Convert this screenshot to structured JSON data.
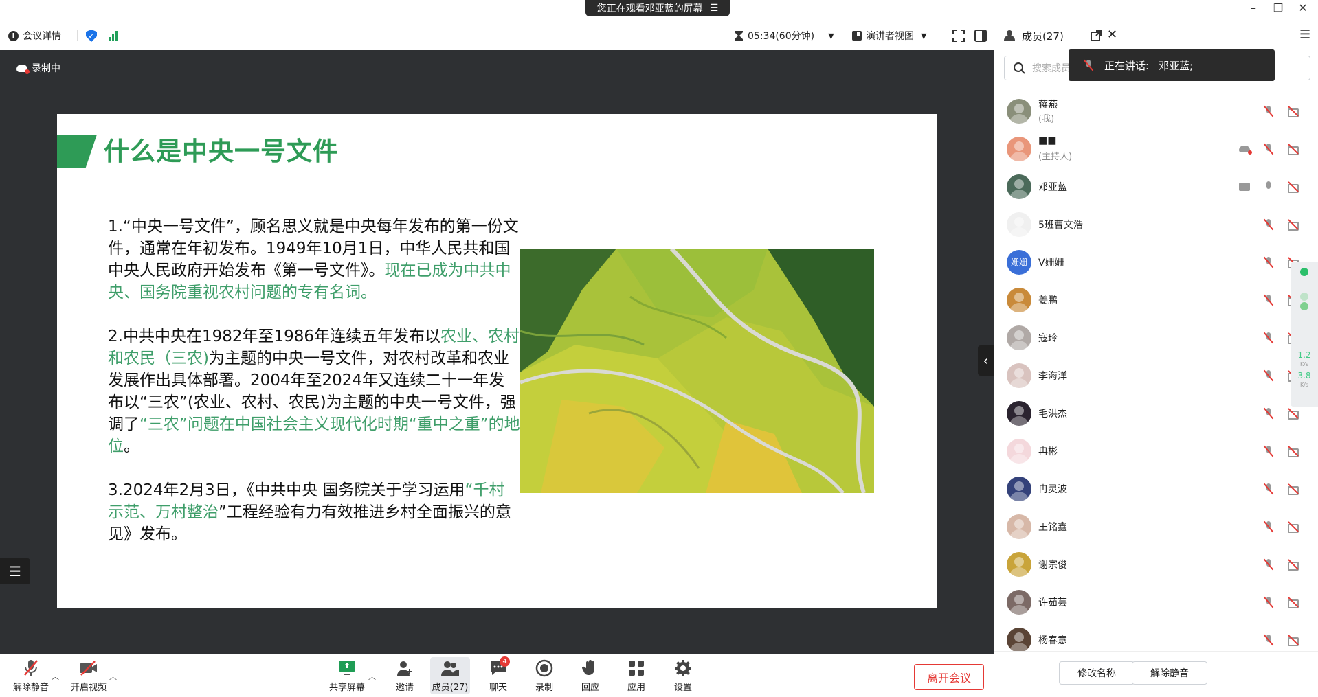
{
  "titlebar": {
    "banner_text": "您正在观看邓亚蓝的屏幕",
    "banner_menu": "☰"
  },
  "toolbar": {
    "meeting_info_label": "会议详情",
    "timer": "05:34(60分钟)",
    "view_mode_label": "演讲者视图"
  },
  "stage": {
    "recording_label": "录制中"
  },
  "slide": {
    "title": "什么是中央一号文件",
    "p1_a": "1.“中央一号文件”，顾名思义就是中央每年发布的第一份文件，通常在年初发布。1949年10月1日，中华人民共和国中央人民政府开始发布《第一号文件》。",
    "p1_b": "现在已成为中共中央、国务院重视农村问题的专有名词。",
    "p2_a": "2.中共中央在1982年至1986年连续五年发布以",
    "p2_b": "农业、农村和农民（三农)",
    "p2_c": "为主题的中央一号文件，对农村改革和农业发展作出具体部署。2004年至2024年又连续二十一年发布以“三农”(农业、农村、农民)为主题的中央一号文件，强调了",
    "p2_d": "“三农”问题在中国社会主义现代化时期“重中之重”的地位",
    "p2_e": "。",
    "p3_a": "3.2024年2月3日，《中共中央 国务院关于学习运用",
    "p3_b": "“千村示范、万村整治",
    "p3_c": "”工程经验有力有效推进乡村全面振兴的意见》发布。"
  },
  "bottombar": {
    "unmute_label": "解除静音",
    "video_label": "开启视频",
    "share_label": "共享屏幕",
    "invite_label": "邀请",
    "members_label": "成员(27)",
    "chat_label": "聊天",
    "chat_badge": "4",
    "record_label": "录制",
    "react_label": "回应",
    "apps_label": "应用",
    "settings_label": "设置",
    "leave_label": "离开会议"
  },
  "panel": {
    "title": "成员(27)",
    "search_placeholder": "搜索成员",
    "speaking_label": "正在讲话:",
    "speaking_name": "邓亚蓝;",
    "rename_label": "修改名称",
    "unmute_label": "解除静音"
  },
  "members": [
    {
      "name": "蒋燕",
      "role": "(我)",
      "color": "#8a8f7a"
    },
    {
      "name": "■■",
      "role": "(主持人)",
      "color": "#e9967a"
    },
    {
      "name": "邓亚蓝",
      "role": "",
      "color": "#4b6a5a"
    },
    {
      "name": "5班曹文浩",
      "role": "",
      "color": "#f0f0f0"
    },
    {
      "name": "V姗姗",
      "role": "",
      "color": "#3a6fd8",
      "initials": "姗姗"
    },
    {
      "name": "姜鹏",
      "role": "",
      "color": "#c98a3a"
    },
    {
      "name": "寇玲",
      "role": "",
      "color": "#b0a9a6"
    },
    {
      "name": "李海洋",
      "role": "",
      "color": "#d9c3bf"
    },
    {
      "name": "毛洪杰",
      "role": "",
      "color": "#2b2430"
    },
    {
      "name": "冉彬",
      "role": "",
      "color": "#f4d8dc"
    },
    {
      "name": "冉灵波",
      "role": "",
      "color": "#34427a"
    },
    {
      "name": "王铭鑫",
      "role": "",
      "color": "#d7b8a8"
    },
    {
      "name": "谢宗俊",
      "role": "",
      "color": "#c9a43a"
    },
    {
      "name": "许茹芸",
      "role": "",
      "color": "#7c6a66"
    },
    {
      "name": "杨春意",
      "role": "",
      "color": "#5a4436"
    }
  ],
  "network": {
    "up": "1.2",
    "down": "3.8",
    "unit": "K/s"
  },
  "colors": {
    "accent_green": "#2e9b56",
    "danger": "#e53935",
    "stage_bg": "#2e3033"
  }
}
